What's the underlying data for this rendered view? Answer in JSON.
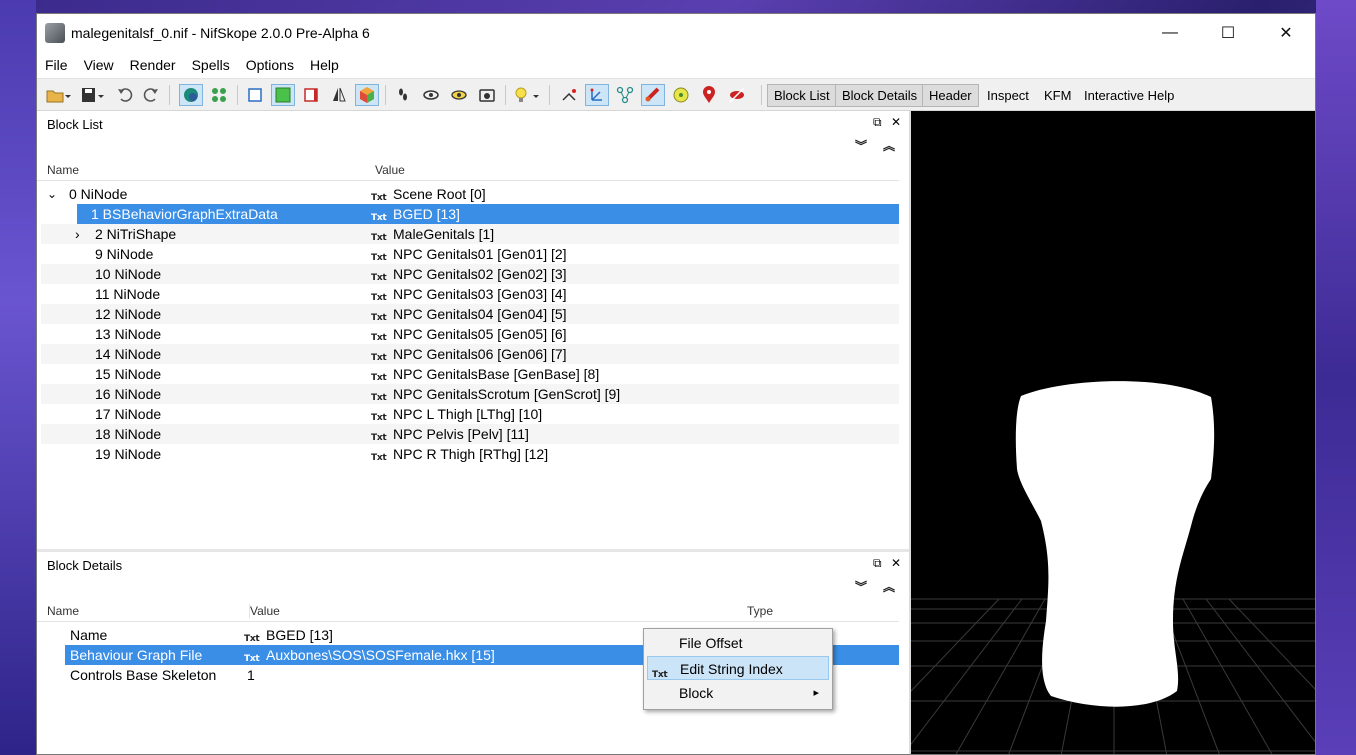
{
  "window": {
    "title": "malegenitalsf_0.nif - NifSkope 2.0.0 Pre-Alpha 6",
    "minimize_glyph": "—",
    "maximize_glyph": "☐",
    "close_glyph": "✕"
  },
  "menu": [
    "File",
    "View",
    "Render",
    "Spells",
    "Options",
    "Help"
  ],
  "toolbar": {
    "buttons": [
      "Block List",
      "Block Details",
      "Header",
      "Inspect",
      "KFM",
      "Interactive Help"
    ]
  },
  "block_list": {
    "title": "Block List",
    "columns": {
      "name": "Name",
      "value": "Value"
    },
    "value_icon_text": "Txt",
    "rows": [
      {
        "expander": "⌄",
        "name": "0 NiNode",
        "value": "Scene Root [0]"
      },
      {
        "expander": "",
        "name": "1 BSBehaviorGraphExtraData",
        "value": "BGED [13]"
      },
      {
        "expander": "›",
        "name": "2 NiTriShape",
        "value": "MaleGenitals [1]"
      },
      {
        "expander": "",
        "name": "9 NiNode",
        "value": "NPC Genitals01 [Gen01] [2]"
      },
      {
        "expander": "",
        "name": "10 NiNode",
        "value": "NPC Genitals02 [Gen02] [3]"
      },
      {
        "expander": "",
        "name": "11 NiNode",
        "value": "NPC Genitals03 [Gen03] [4]"
      },
      {
        "expander": "",
        "name": "12 NiNode",
        "value": "NPC Genitals04 [Gen04] [5]"
      },
      {
        "expander": "",
        "name": "13 NiNode",
        "value": "NPC Genitals05 [Gen05] [6]"
      },
      {
        "expander": "",
        "name": "14 NiNode",
        "value": "NPC Genitals06 [Gen06] [7]"
      },
      {
        "expander": "",
        "name": "15 NiNode",
        "value": "NPC GenitalsBase [GenBase] [8]"
      },
      {
        "expander": "",
        "name": "16 NiNode",
        "value": "NPC GenitalsScrotum [GenScrot] [9]"
      },
      {
        "expander": "",
        "name": "17 NiNode",
        "value": "NPC L Thigh [LThg] [10]"
      },
      {
        "expander": "",
        "name": "18 NiNode",
        "value": "NPC Pelvis [Pelv] [11]"
      },
      {
        "expander": "",
        "name": "19 NiNode",
        "value": "NPC R Thigh [RThg] [12]"
      }
    ]
  },
  "block_details": {
    "title": "Block Details",
    "columns": {
      "name": "Name",
      "value": "Value",
      "type": "Type"
    },
    "value_icon_text": "Txt",
    "rows": [
      {
        "name": "Name",
        "value": "BGED [13]",
        "has_icon": true
      },
      {
        "name": "Behaviour Graph File",
        "value": "Auxbones\\SOS\\SOSFemale.hkx [15]",
        "has_icon": true
      },
      {
        "name": "Controls Base Skeleton",
        "value": "1",
        "has_icon": false
      }
    ]
  },
  "context_menu": {
    "items": [
      {
        "label": "File Offset",
        "icon_text": ""
      },
      {
        "label": "Edit String Index",
        "icon_text": "Txt"
      },
      {
        "label": "Block",
        "icon_text": "",
        "submenu_glyph": "▸"
      }
    ]
  },
  "colors": {
    "selection": "#3a8ee6",
    "viewport_bg": "#000000",
    "mesh_fill": "#ffffff",
    "grid_line": "#3a3a3a"
  }
}
